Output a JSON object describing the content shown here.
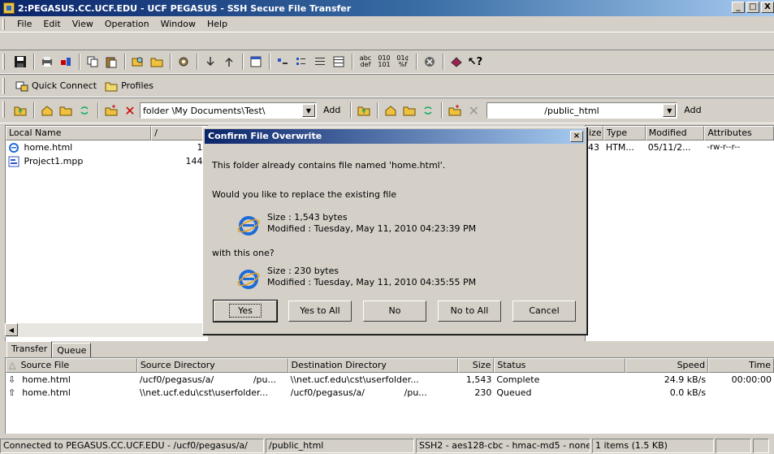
{
  "window": {
    "title": "2:PEGASUS.CC.UCF.EDU - UCF PEGASUS - SSH Secure File Transfer",
    "min": "_",
    "max": "□",
    "close": "X"
  },
  "menu": {
    "items": [
      "File",
      "Edit",
      "View",
      "Operation",
      "Window",
      "Help"
    ]
  },
  "quick_connect": {
    "connect_label": "Quick Connect",
    "profiles_label": "Profiles"
  },
  "left_path": {
    "prefix": "folder",
    "value": "\\My Documents\\Test\\",
    "add_label": "Add"
  },
  "right_path": {
    "value": "/public_html",
    "add_label": "Add"
  },
  "local_pane": {
    "headers": [
      "Local Name",
      "/"
    ],
    "files": [
      {
        "name": "home.html",
        "size": "1,"
      },
      {
        "name": "Project1.mpp",
        "size": "144,"
      }
    ]
  },
  "remote_pane": {
    "headers": [
      "ize",
      "Type",
      "Modified",
      "Attributes"
    ],
    "files": [
      {
        "size": "43",
        "type": "HTM...",
        "modified": "05/11/2...",
        "attributes": "-rw-r--r--"
      }
    ]
  },
  "dialog": {
    "title": "Confirm File Overwrite",
    "close": "×",
    "message": "This folder already contains file named 'home.html'.",
    "question": "Would you like to replace the existing file",
    "existing_size": "Size : 1,543 bytes",
    "existing_modified": "Modified : Tuesday, May 11, 2010 04:23:39 PM",
    "with_label": "with this one?",
    "new_size": "Size : 230 bytes",
    "new_modified": "Modified : Tuesday, May 11, 2010 04:35:55 PM",
    "buttons": [
      "Yes",
      "Yes to All",
      "No",
      "No to All",
      "Cancel"
    ]
  },
  "tabs": [
    "Transfer",
    "Queue"
  ],
  "transfer": {
    "headers": [
      "Source File",
      "Source Directory",
      "Destination Directory",
      "Size",
      "Status",
      "Speed",
      "Time"
    ],
    "rows": [
      {
        "dir_icon": "download-arrow-icon",
        "file": "home.html",
        "source": "/ucf0/pegasus/a/",
        "source2": "/pu...",
        "dest": "\\\\net.ucf.edu\\cst\\userfolder...",
        "dest2": "",
        "size": "1,543",
        "status": "Complete",
        "speed": "24.9 kB/s",
        "time": "00:00:00"
      },
      {
        "dir_icon": "upload-arrow-icon",
        "file": "home.html",
        "source": "\\\\net.ucf.edu\\cst\\userfolder...",
        "source2": "",
        "dest": "/ucf0/pegasus/a/",
        "dest2": "/pu...",
        "size": "230",
        "status": "Queued",
        "speed": "0.0 kB/s",
        "time": ""
      }
    ]
  },
  "status": {
    "connection": "Connected to PEGASUS.CC.UCF.EDU - /ucf0/pegasus/a/",
    "remote_path": "/public_html",
    "cipher": "SSH2 - aes128-cbc - hmac-md5 - none",
    "items": "1 items (1.5 KB)"
  }
}
